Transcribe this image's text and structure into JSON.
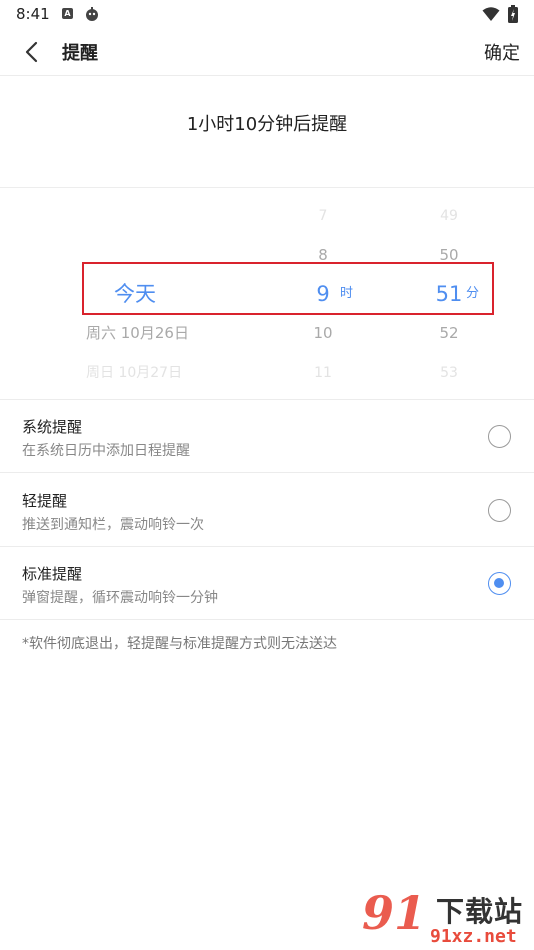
{
  "status_bar": {
    "time": "8:41",
    "icons": [
      "a-box-icon",
      "robot-icon",
      "wifi-icon",
      "battery-icon"
    ]
  },
  "nav": {
    "back_icon": "chevron-left-icon",
    "title": "提醒",
    "confirm_label": "确定"
  },
  "summary": "1小时10分钟后提醒",
  "picker": {
    "rows": [
      {
        "day": "",
        "hour": "7",
        "minute": "49"
      },
      {
        "day": "",
        "hour": "8",
        "minute": "50"
      },
      {
        "day": "今天",
        "hour": "9",
        "minute": "51"
      },
      {
        "day": "周六 10月26日",
        "hour": "10",
        "minute": "52"
      },
      {
        "day": "周日 10月27日",
        "hour": "11",
        "minute": "53"
      }
    ],
    "hour_unit": "时",
    "minute_unit": "分"
  },
  "options": [
    {
      "title": "系统提醒",
      "desc": "在系统日历中添加日程提醒",
      "selected": false
    },
    {
      "title": "轻提醒",
      "desc": "推送到通知栏，震动响铃一次",
      "selected": false
    },
    {
      "title": "标准提醒",
      "desc": "弹窗提醒，循环震动响铃一分钟",
      "selected": true
    }
  ],
  "footnote": "*软件彻底退出，轻提醒与标准提醒方式则无法送达",
  "watermark": {
    "cn": "下载站",
    "url": "91xz.net"
  },
  "colors": {
    "accent": "#4f8ef0",
    "highlight_border": "#d9232d"
  }
}
